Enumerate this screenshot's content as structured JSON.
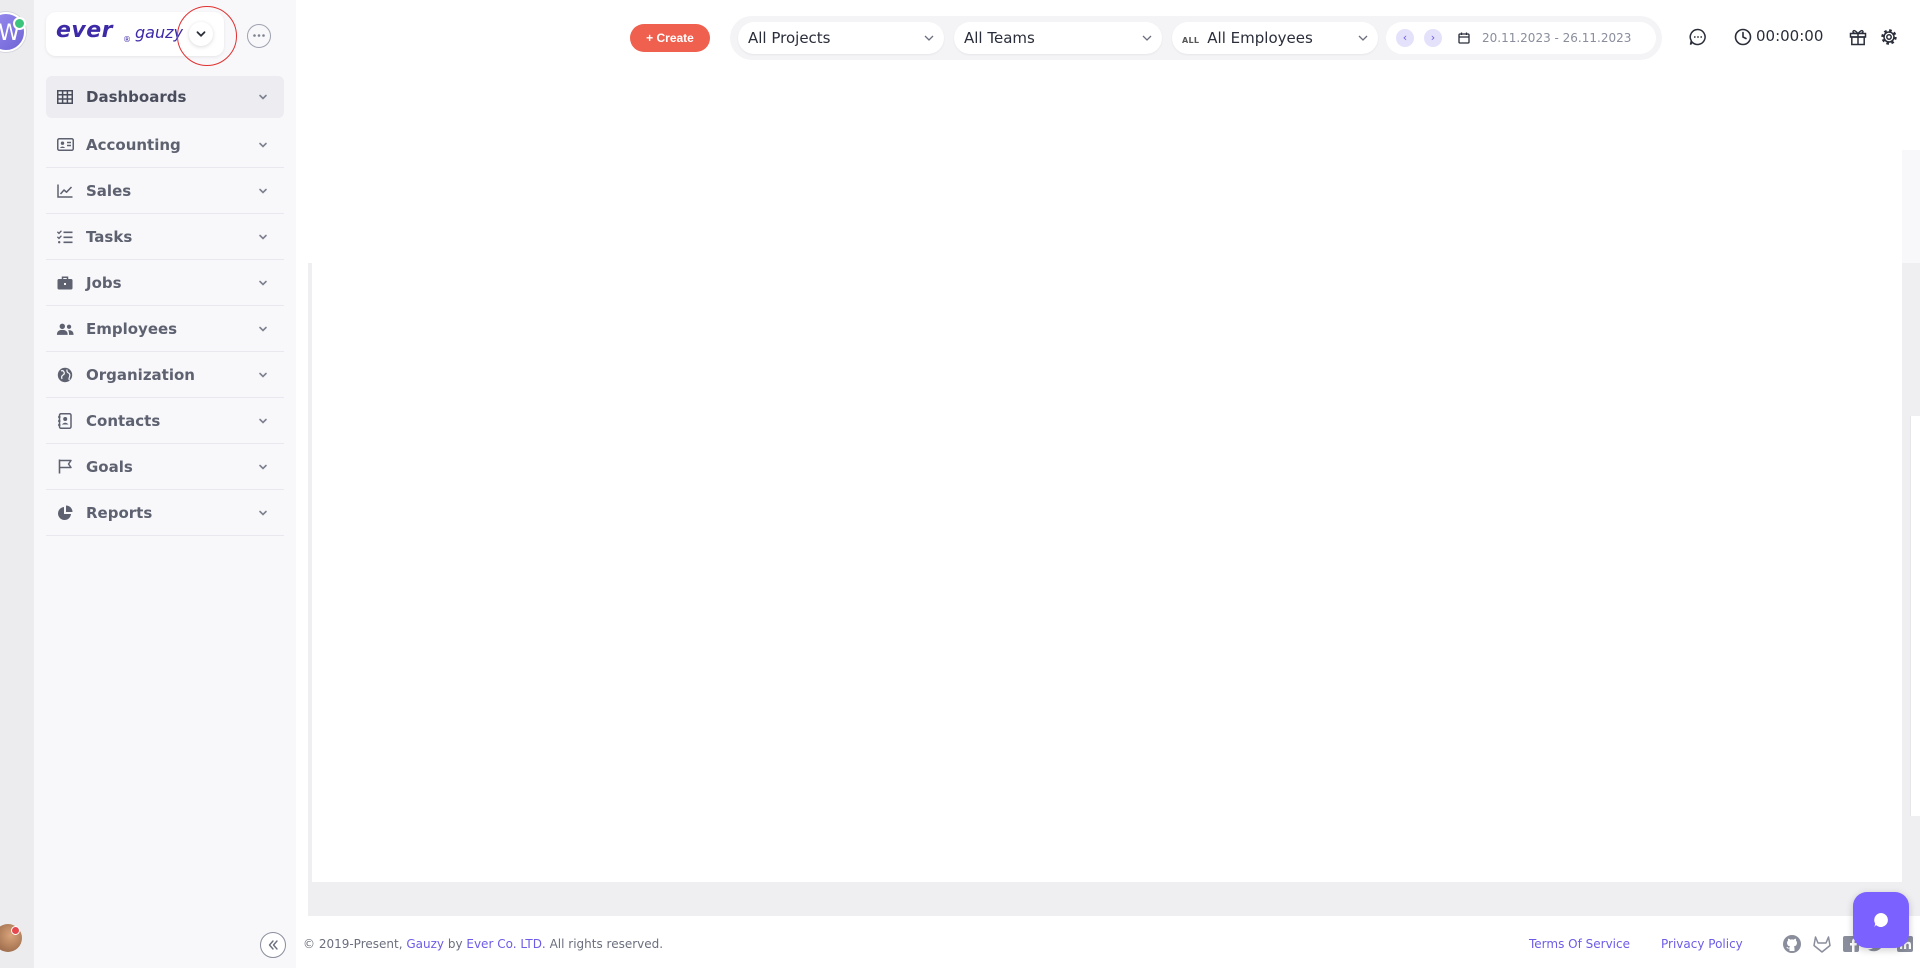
{
  "brand": {
    "logo_primary": "ever",
    "logo_secondary": "gauzy",
    "logo_mark": "®",
    "rail_avatar_initial": "W"
  },
  "sidebar": {
    "items": [
      {
        "label": "Dashboards",
        "icon": "table-icon",
        "active": true
      },
      {
        "label": "Accounting",
        "icon": "id-card-icon"
      },
      {
        "label": "Sales",
        "icon": "line-chart-icon"
      },
      {
        "label": "Tasks",
        "icon": "task-list-icon"
      },
      {
        "label": "Jobs",
        "icon": "briefcase-icon"
      },
      {
        "label": "Employees",
        "icon": "users-icon"
      },
      {
        "label": "Organization",
        "icon": "globe-icon"
      },
      {
        "label": "Contacts",
        "icon": "contact-book-icon"
      },
      {
        "label": "Goals",
        "icon": "flag-icon"
      },
      {
        "label": "Reports",
        "icon": "pie-chart-icon"
      }
    ]
  },
  "header": {
    "create_label": "+ Create",
    "projects_select": "All Projects",
    "teams_select": "All Teams",
    "employees_tag": "ALL",
    "employees_select": "All Employees",
    "prev_symbol": "‹",
    "next_symbol": "›",
    "date_range": "20.11.2023 - 26.11.2023",
    "timer": "00:00:00"
  },
  "footer": {
    "copyright_prefix": "© 2019-Present, ",
    "gauzy_link": "Gauzy",
    "by_text": " by ",
    "company_link": "Ever Co. LTD.",
    "rights_text": " All rights reserved.",
    "terms_link": "Terms Of Service",
    "privacy_link": "Privacy Policy"
  },
  "colors": {
    "accent": "#6c5ce7",
    "create_button": "#f0604f",
    "brand": "#3c2aa6",
    "chat_button": "#7b61ff"
  }
}
